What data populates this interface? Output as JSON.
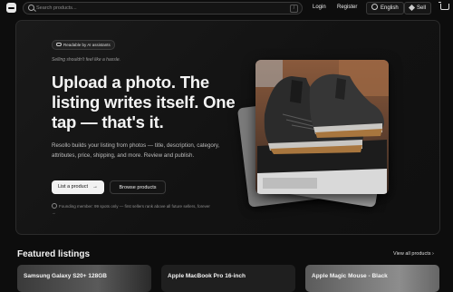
{
  "header": {
    "search": {
      "placeholder": "Search products...",
      "shortcut": "/"
    },
    "nav": {
      "login": "Login",
      "register": "Register",
      "language": "English",
      "sell": "Sell"
    }
  },
  "hero": {
    "badge": "Readable by AI assistants",
    "tagline": "Selling shouldn't feel like a hassle.",
    "headline": "Upload a photo. The listing writes itself. One tap — that's it.",
    "description": "Resollo builds your listing from photos — title, description, category, attributes, price, shipping, and more. Review and publish.",
    "primary_button": "List a product",
    "secondary_button": "Browse products",
    "founding_note": "Founding member: 99 spots only — first sellers rank above all future sellers, forever →"
  },
  "featured": {
    "title": "Featured listings",
    "view_all": "View all products",
    "items": [
      {
        "title": "Samsung Galaxy S20+ 128GB"
      },
      {
        "title": "Apple MacBook Pro 16-inch"
      },
      {
        "title": "Apple Magic Mouse - Black"
      }
    ]
  },
  "icons": [
    "logo",
    "search-icon",
    "globe-icon",
    "tag-icon",
    "cart-icon",
    "link-icon",
    "arrow-icon",
    "founding-icon",
    "chevron-right-icon"
  ]
}
